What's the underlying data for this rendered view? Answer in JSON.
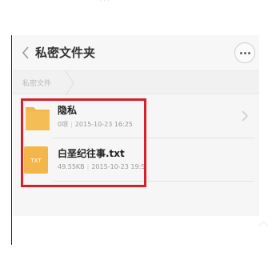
{
  "header": {
    "title": "私密文件夹",
    "back_icon": "chevron-left-icon",
    "more_icon": "more-dots-icon"
  },
  "breadcrumb": {
    "label": "私密文件"
  },
  "files": [
    {
      "name": "隐私",
      "icon": "folder-icon",
      "icon_color": "#f3b64a",
      "count": "0项",
      "date": "2015-10-23 16:25"
    },
    {
      "name": "白垩纪往事.txt",
      "icon": "txt-file-icon",
      "icon_label": "TXT",
      "icon_color": "#f3b64a",
      "size": "49.55KB",
      "date": "2015-10-23 19:5"
    }
  ],
  "highlight_color": "#d6202a",
  "ghost_dots": "···"
}
